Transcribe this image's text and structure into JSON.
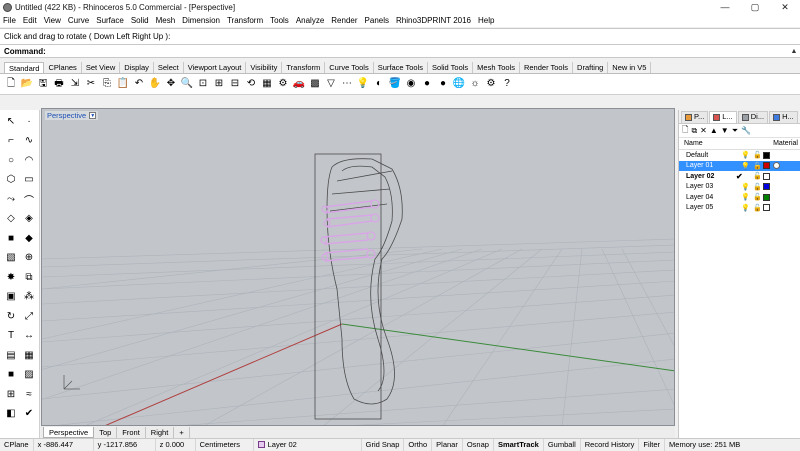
{
  "window": {
    "title": "Untitled (422 KB) - Rhinoceros 5.0 Commercial - [Perspective]",
    "minimize": "—",
    "maximize": "▢",
    "close": "✕"
  },
  "menu": [
    "File",
    "Edit",
    "View",
    "Curve",
    "Surface",
    "Solid",
    "Mesh",
    "Dimension",
    "Transform",
    "Tools",
    "Analyze",
    "Render",
    "Panels",
    "Rhino3DPRINT 2016",
    "Help"
  ],
  "command": {
    "history": "Click and drag to rotate ( Down  Left  Right  Up ):",
    "label": "Command:",
    "value": ""
  },
  "toolbar_tabs": [
    "Standard",
    "CPlanes",
    "Set View",
    "Display",
    "Select",
    "Viewport Layout",
    "Visibility",
    "Transform",
    "Curve Tools",
    "Surface Tools",
    "Solid Tools",
    "Mesh Tools",
    "Render Tools",
    "Drafting",
    "New in V5"
  ],
  "toolbar_icons": [
    "new-icon",
    "open-icon",
    "save-icon",
    "print-icon",
    "import-icon",
    "cut-icon",
    "copy-icon",
    "paste-icon",
    "undo-icon",
    "pan-icon",
    "move-icon",
    "zoom-icon",
    "zoom-window-icon",
    "zoom-extents-icon",
    "zoom-selected-icon",
    "rotate-view-icon",
    "four-views-icon",
    "options-icon",
    "car-icon",
    "grid-icon",
    "select-filter-icon",
    "edit-points-icon",
    "lightbulb-icon",
    "render-icon",
    "bucket-icon",
    "color-wheel-icon",
    "sphere-icon",
    "sphere-icon-2",
    "globe-icon",
    "sun-icon",
    "settings-icon",
    "help-icon"
  ],
  "toolbar_glyphs": [
    "🗋",
    "📂",
    "🖫",
    "🖶",
    "⇲",
    "✂",
    "⎘",
    "📋",
    "↶",
    "✋",
    "✥",
    "🔍",
    "⊡",
    "⊞",
    "⊟",
    "⟲",
    "▦",
    "⚙",
    "🚗",
    "▩",
    "▽",
    "⋯",
    "💡",
    "◐",
    "🪣",
    "◉",
    "●",
    "●",
    "🌐",
    "☼",
    "⚙",
    "?"
  ],
  "left_tools": [
    "arrow-icon",
    "point-icon",
    "polyline-icon",
    "curve-icon",
    "circle-icon",
    "arc-icon",
    "polygon-icon",
    "rectangle-icon",
    "curve-edit-icon",
    "fillet-icon",
    "surface-icon",
    "loft-icon",
    "box-icon",
    "solid-edit-icon",
    "mesh-icon",
    "boolean-icon",
    "explode-icon",
    "join-icon",
    "group-icon",
    "array-icon",
    "rotate-icon",
    "scale-icon",
    "text-icon",
    "dimension-icon",
    "layout-icon",
    "block-icon",
    "cube-icon",
    "sheet-icon",
    "grid-snap-icon",
    "spring-icon",
    "bucket-fill-icon",
    "check-icon"
  ],
  "left_glyphs": [
    "↖",
    "·",
    "⌐",
    "∿",
    "○",
    "◠",
    "⬡",
    "▭",
    "⤳",
    "⌒",
    "◇",
    "◈",
    "■",
    "◆",
    "▧",
    "⊕",
    "✸",
    "⧉",
    "▣",
    "⁂",
    "↻",
    "⤢",
    "T",
    "↔",
    "▤",
    "▦",
    "■",
    "▨",
    "⊞",
    "≈",
    "◧",
    "✔"
  ],
  "viewport": {
    "label": "Perspective",
    "tabs": [
      "Perspective",
      "Top",
      "Front",
      "Right",
      "+"
    ]
  },
  "panel": {
    "tabs": [
      "P...",
      "L...",
      "Di...",
      "H..."
    ],
    "header_name": "Name",
    "header_material": "Material",
    "layers": [
      {
        "name": "Default",
        "color": "#000000",
        "state": ""
      },
      {
        "name": "Layer 01",
        "color": "#cc0000",
        "state": "selected"
      },
      {
        "name": "Layer 02",
        "color": "#ffffff",
        "state": "current"
      },
      {
        "name": "Layer 03",
        "color": "#0000e0",
        "state": ""
      },
      {
        "name": "Layer 04",
        "color": "#008000",
        "state": ""
      },
      {
        "name": "Layer 05",
        "color": "#ffffff",
        "state": ""
      }
    ],
    "current_check": "✔"
  },
  "status": {
    "cplane": "CPlane",
    "x": "x -886.447",
    "y": "y -1217.856",
    "z": "z 0.000",
    "units": "Centimeters",
    "layer": "Layer 02",
    "toggles": [
      "Grid Snap",
      "Ortho",
      "Planar",
      "Osnap",
      "SmartTrack",
      "Gumball",
      "Record History",
      "Filter"
    ],
    "memory": "Memory use: 251 MB"
  }
}
